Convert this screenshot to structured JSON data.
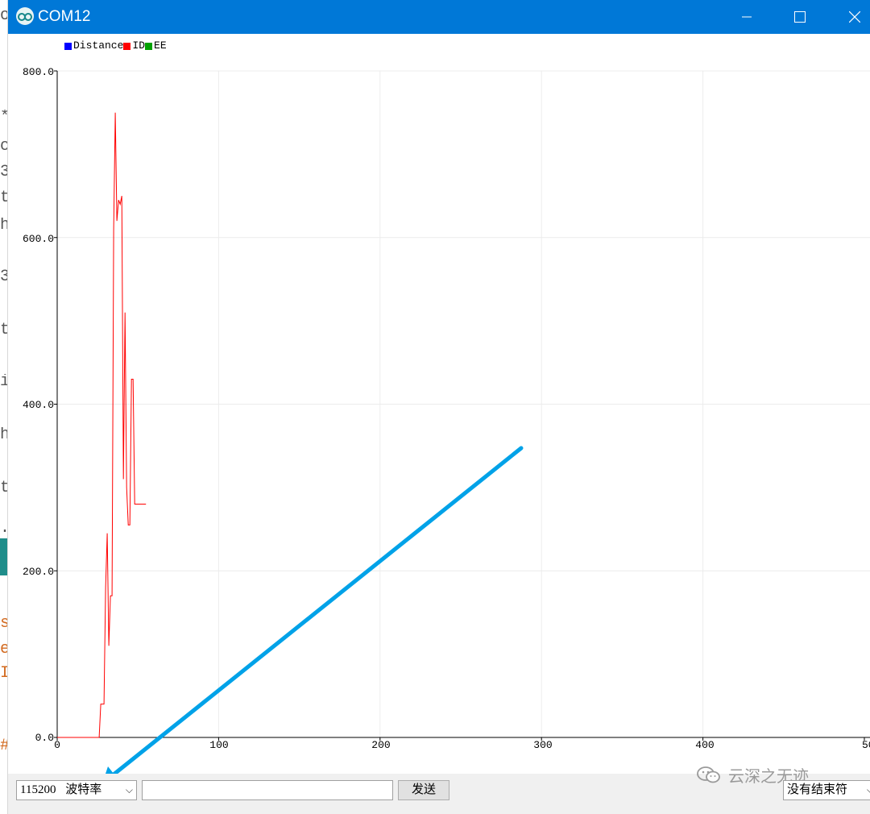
{
  "window": {
    "title": "COM12",
    "app_icon": "arduino-infinity-icon"
  },
  "background_fragments": [
    "o",
    "*",
    "c",
    "3",
    "t",
    "h",
    "3",
    "t",
    "i",
    "h",
    "t",
    ".",
    "s",
    "e",
    "I",
    "#"
  ],
  "chart_data": {
    "type": "line",
    "legend": [
      "Distance",
      "ID",
      "EE"
    ],
    "series": [
      {
        "name": "Distance",
        "color": "#0000ff",
        "x": [],
        "y": []
      },
      {
        "name": "ID",
        "color": "#ff0000",
        "x": [
          0,
          1,
          2,
          3,
          4,
          5,
          6,
          7,
          8,
          9,
          10,
          11,
          12,
          13,
          14,
          15,
          16,
          17,
          18,
          19,
          20,
          21,
          22,
          23,
          24,
          25,
          26,
          27,
          28,
          29,
          30,
          31,
          32,
          33,
          34,
          35,
          36,
          37,
          38,
          39,
          40,
          41,
          42,
          43,
          44,
          45,
          46,
          47,
          48,
          49,
          50,
          51,
          52,
          53,
          54,
          55
        ],
        "y": [
          0,
          0,
          0,
          0,
          0,
          0,
          0,
          0,
          0,
          0,
          0,
          0,
          0,
          0,
          0,
          0,
          0,
          0,
          0,
          0,
          0,
          0,
          0,
          0,
          0,
          0,
          0,
          40,
          40,
          40,
          180,
          245,
          110,
          170,
          170,
          610,
          750,
          620,
          645,
          640,
          650,
          310,
          510,
          300,
          255,
          255,
          430,
          430,
          280,
          280,
          280,
          280,
          280,
          280,
          280,
          280
        ]
      },
      {
        "name": "EE",
        "color": "#00a000",
        "x": [],
        "y": []
      }
    ],
    "x_ticks": [
      "0",
      "100",
      "200",
      "300",
      "400",
      "50"
    ],
    "y_ticks": [
      "0.0",
      "200.0",
      "400.0",
      "600.0",
      "800.0"
    ],
    "xlim": [
      0,
      500
    ],
    "ylim": [
      0,
      800
    ],
    "grid": true
  },
  "annotation": {
    "type": "arrow",
    "color": "#00a2e8"
  },
  "bottom_bar": {
    "baud_value": "115200",
    "baud_label": "波特率",
    "input_value": "",
    "send_label": "发送",
    "line_ending": "没有结束符"
  },
  "watermark": {
    "text": "云深之无迹",
    "icon": "wechat-icon"
  }
}
